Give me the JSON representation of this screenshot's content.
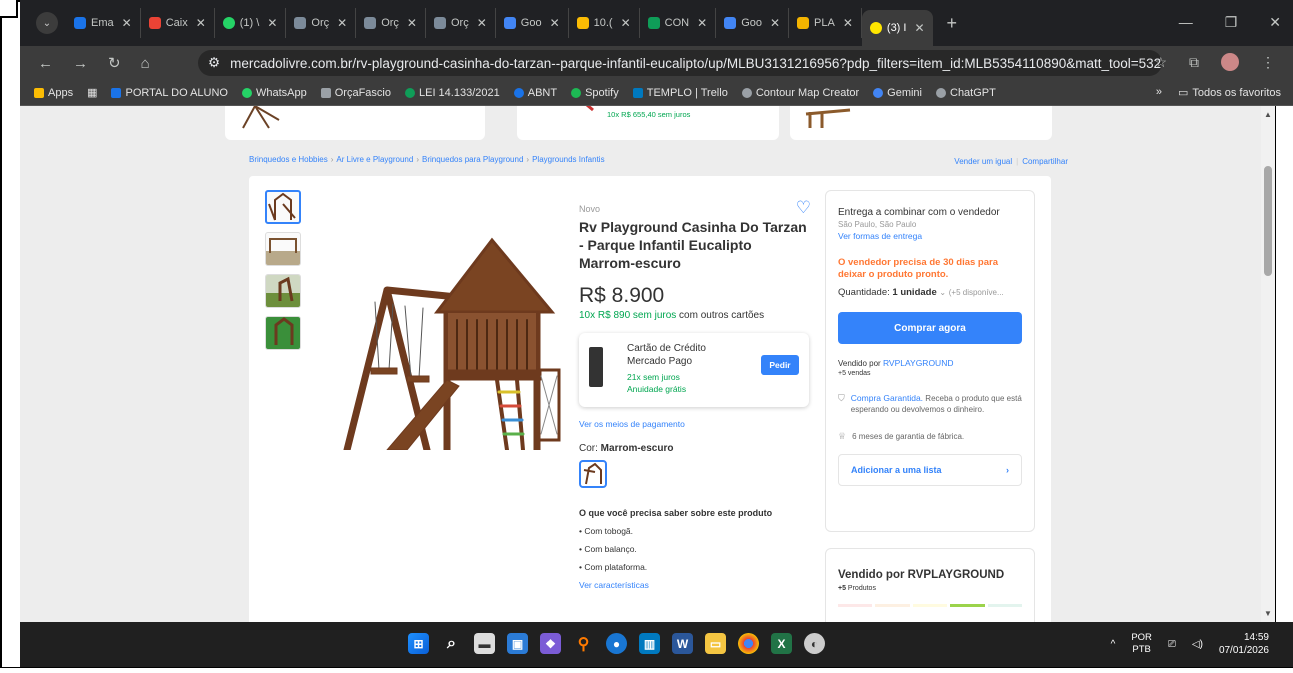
{
  "tabs": [
    {
      "label": "Ema",
      "color": "#1a73e8"
    },
    {
      "label": "Caix",
      "color": "#ea4335"
    },
    {
      "label": "(1) \\",
      "color": "#25d366"
    },
    {
      "label": "Orç",
      "color": "#7c8b9a"
    },
    {
      "label": "Orç",
      "color": "#7c8b9a"
    },
    {
      "label": "Orç",
      "color": "#7c8b9a"
    },
    {
      "label": "Goo",
      "color": "#4285f4"
    },
    {
      "label": "10.(",
      "color": "#fbbc04"
    },
    {
      "label": "CON",
      "color": "#0f9d58"
    },
    {
      "label": "Goo",
      "color": "#4285f4"
    },
    {
      "label": "PLA",
      "color": "#f4b400"
    },
    {
      "label": "(3) I",
      "color": "#ffe600",
      "active": true
    }
  ],
  "browser": {
    "url": "mercadolivre.com.br/rv-playground-casinha-do-tarzan--parque-infantil-eucalipto/up/MLBU3131216956?pdp_filters=item_id:MLB5354110890&matt_tool=532...",
    "bookmarks": [
      {
        "label": "Apps",
        "color": "#fbbc04"
      },
      {
        "label": "PORTAL DO ALUNO",
        "color": "#1a73e8"
      },
      {
        "label": "WhatsApp",
        "color": "#25d366"
      },
      {
        "label": "OrçaFascio",
        "color": "#9aa0a6"
      },
      {
        "label": "LEI 14.133/2021",
        "color": "#0f9d58"
      },
      {
        "label": "ABNT",
        "color": "#1a73e8"
      },
      {
        "label": "Spotify",
        "color": "#1db954"
      },
      {
        "label": "TEMPLO | Trello",
        "color": "#0079bf"
      },
      {
        "label": "Contour Map Creator",
        "color": "#9aa0a6"
      },
      {
        "label": "Gemini",
        "color": "#4285f4"
      },
      {
        "label": "ChatGPT",
        "color": "#9aa0a6"
      }
    ],
    "all_bookmarks": "Todos os favoritos"
  },
  "top_strip": {
    "installment": "10x R$ 655,40 sem juros"
  },
  "breadcrumbs": [
    "Brinquedos e Hobbies",
    "Ar Livre e Playground",
    "Brinquedos para Playground",
    "Playgrounds Infantis"
  ],
  "actions": {
    "sell_same": "Vender um igual",
    "share": "Compartilhar"
  },
  "product": {
    "condition": "Novo",
    "title": "Rv Playground Casinha Do Tarzan - Parque Infantil Eucalipto Marrom-escuro",
    "price": "R$ 8.900",
    "installments_green": "10x R$ 890 sem juros",
    "installments_rest": " com outros cartões",
    "card_title": "Cartão de Crédito Mercado Pago",
    "card_line1": "21x sem juros",
    "card_line2": "Anuidade grátis",
    "card_button": "Pedir",
    "payment_link": "Ver os meios de pagamento",
    "color_label": "Cor: ",
    "color_value": "Marrom-escuro",
    "features_title": "O que você precisa saber sobre este produto",
    "features": [
      "Com tobogã.",
      "Com balanço.",
      "Com plataforma."
    ],
    "features_link": "Ver características"
  },
  "buybox": {
    "delivery": "Entrega a combinar com o vendedor",
    "location": "São Paulo, São Paulo",
    "delivery_link": "Ver formas de entrega",
    "notice": "O vendedor precisa de 30 dias para deixar o produto pronto.",
    "qty_label": "Quantidade: ",
    "qty_value": "1 unidade",
    "qty_available": "(+5 disponíve...",
    "buy_button": "Comprar agora",
    "sold_by": "Vendido por ",
    "seller": "RVPLAYGROUND",
    "sales": "+5 vendas",
    "guarantee_link": "Compra Garantida.",
    "guarantee_text": " Receba o produto que está esperando ou devolvemos o dinheiro.",
    "warranty": "6 meses de garantia de fábrica.",
    "add_list": "Adicionar a uma lista"
  },
  "seller_box": {
    "title": "Vendido por RVPLAYGROUND",
    "products_count": "+5",
    "products_label": " Produtos"
  },
  "taskbar": {
    "lang1": "POR",
    "lang2": "PTB",
    "time": "14:59",
    "date": "07/01/2026"
  }
}
